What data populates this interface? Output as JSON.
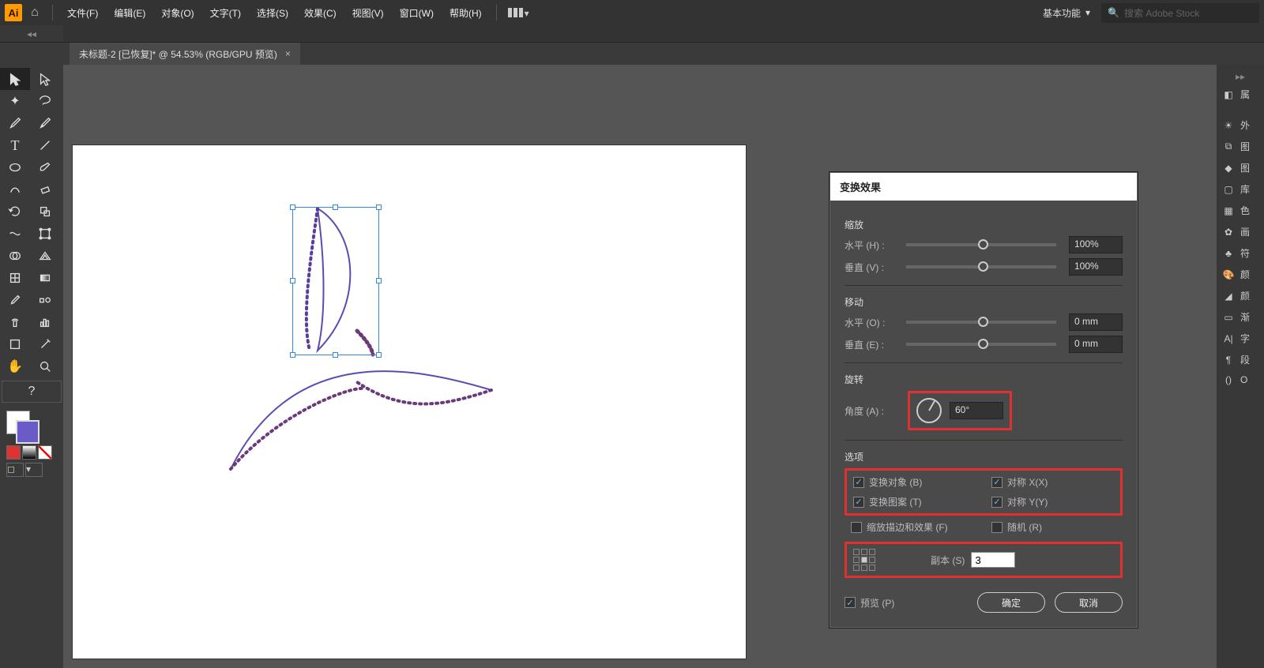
{
  "menubar": {
    "logo": "Ai",
    "items": [
      "文件(F)",
      "编辑(E)",
      "对象(O)",
      "文字(T)",
      "选择(S)",
      "效果(C)",
      "视图(V)",
      "窗口(W)",
      "帮助(H)"
    ],
    "workspace": "基本功能",
    "search_placeholder": "搜索 Adobe Stock"
  },
  "doc_tab": {
    "title": "未标题-2 [已恢复]* @ 54.53% (RGB/GPU 预览)",
    "close": "×"
  },
  "dialog": {
    "title": "变换效果",
    "scale": {
      "label": "缩放",
      "h_label": "水平 (H) :",
      "v_label": "垂直 (V) :",
      "h_value": "100%",
      "v_value": "100%"
    },
    "move": {
      "label": "移动",
      "h_label": "水平 (O) :",
      "v_label": "垂直 (E) :",
      "h_value": "0 mm",
      "v_value": "0 mm"
    },
    "rotate": {
      "label": "旋转",
      "angle_label": "角度 (A) :",
      "angle_value": "60°"
    },
    "options": {
      "label": "选项",
      "transform_obj": "变换对象 (B)",
      "reflect_x": "对称 X(X)",
      "transform_pat": "变换图案 (T)",
      "reflect_y": "对称 Y(Y)",
      "scale_stroke": "缩放描边和效果 (F)",
      "random": "随机 (R)"
    },
    "copies_label": "副本 (S)",
    "copies_value": "3",
    "preview": "预览 (P)",
    "ok": "确定",
    "cancel": "取消"
  },
  "right_dock": {
    "items": [
      {
        "icon": "◧",
        "label": "属"
      },
      {
        "icon": "☀",
        "label": "外"
      },
      {
        "icon": "⧉",
        "label": "图"
      },
      {
        "icon": "◆",
        "label": "图"
      },
      {
        "icon": "▢",
        "label": "库"
      },
      {
        "icon": "▦",
        "label": "色"
      },
      {
        "icon": "✿",
        "label": "画"
      },
      {
        "icon": "♣",
        "label": "符"
      },
      {
        "icon": "🎨",
        "label": "颜"
      },
      {
        "icon": "◢",
        "label": "颜"
      },
      {
        "icon": "▭",
        "label": "渐"
      },
      {
        "icon": "A|",
        "label": "字"
      },
      {
        "icon": "¶",
        "label": "段"
      },
      {
        "icon": "()",
        "label": "O"
      }
    ]
  }
}
